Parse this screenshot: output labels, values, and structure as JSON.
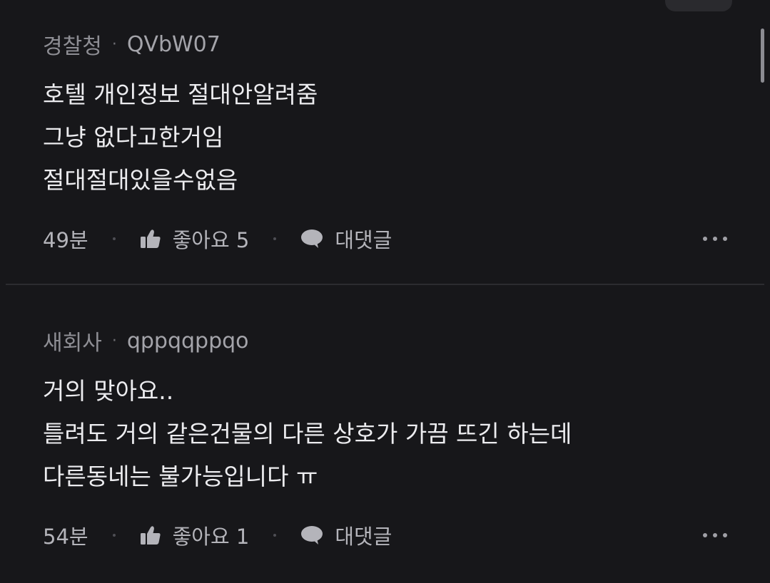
{
  "comments": [
    {
      "author": "경찰청",
      "handle": "QVbW07",
      "lines": [
        "호텔 개인정보 절대안알려줌",
        "그냥 없다고한거임",
        "절대절대있을수없음"
      ],
      "time": "49분",
      "like_label": "좋아요 5",
      "reply_label": "대댓글"
    },
    {
      "author": "새회사",
      "handle": "qppqqppqo",
      "lines": [
        "거의 맞아요..",
        "틀려도 거의 같은건물의 다른 상호가 가끔 뜨긴 하는데",
        "다른동네는 불가능입니다 ㅠ"
      ],
      "time": "54분",
      "like_label": "좋아요 1",
      "reply_label": "대댓글"
    }
  ],
  "separator": "·",
  "icons": {
    "like": "thumbs-up-icon",
    "reply": "speech-bubble-icon",
    "more": "more-options-icon"
  },
  "colors": {
    "background": "#17171a",
    "text": "#ececef",
    "muted": "#8e8e94"
  }
}
